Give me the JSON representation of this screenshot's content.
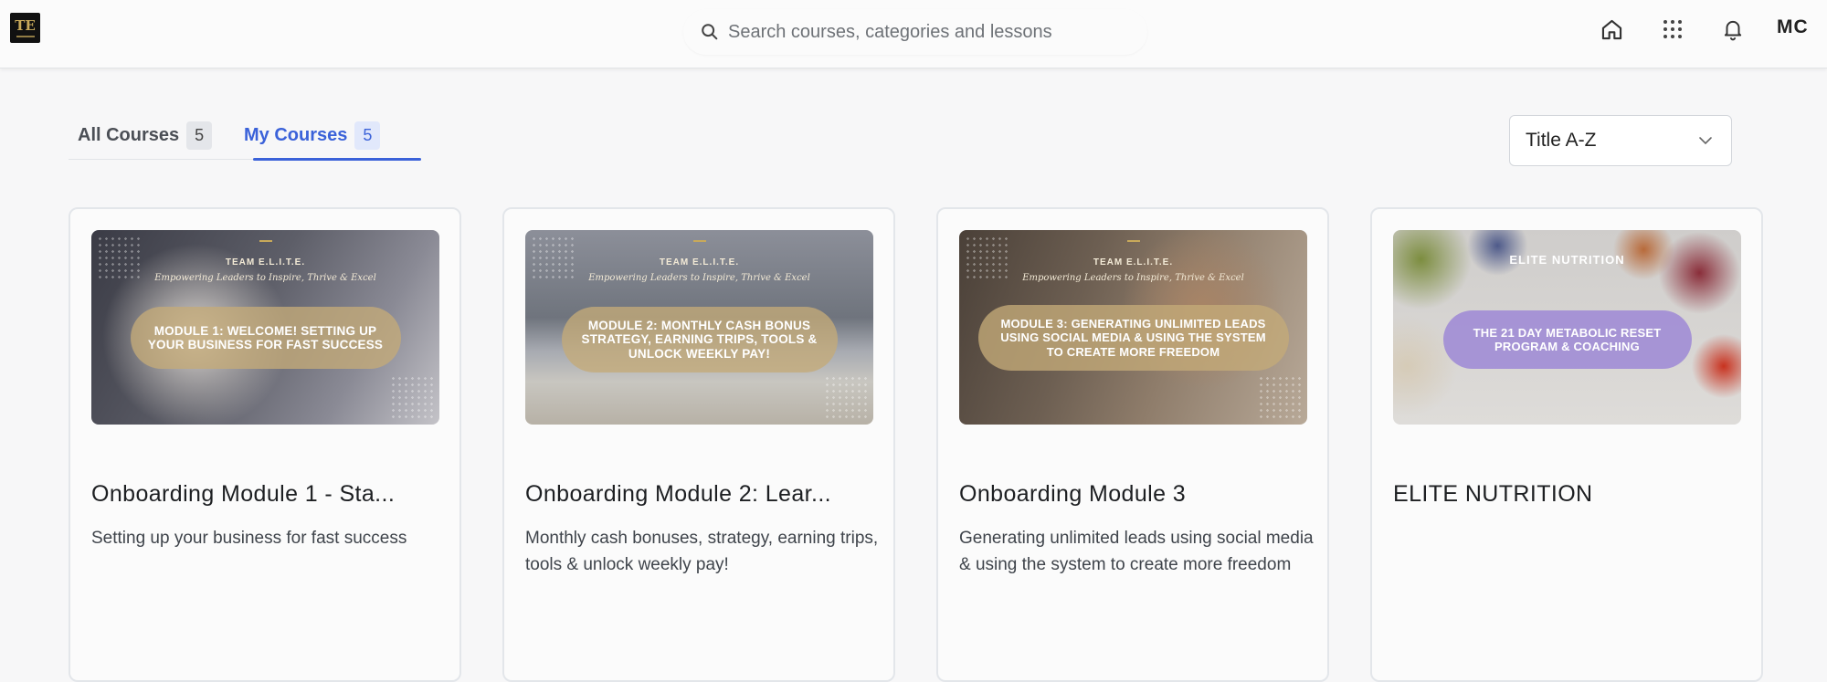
{
  "header": {
    "logo_alt": "Team E.L.I.T.E. logo",
    "search_placeholder": "Search courses, categories and lessons",
    "icons": [
      "home-icon",
      "apps-grid-icon",
      "bell-icon"
    ],
    "user_initials": "MC"
  },
  "tabs": [
    {
      "label": "All Courses",
      "count": "5",
      "active": false
    },
    {
      "label": "My Courses",
      "count": "5",
      "active": true
    }
  ],
  "sort": {
    "selected": "Title A-Z"
  },
  "courses": [
    {
      "image_brand": "TEAM E.L.I.T.E.",
      "image_tagline": "Empowering Leaders to Inspire, Thrive & Excel",
      "image_text": "MODULE 1:  WELCOME! SETTING UP YOUR BUSINESS FOR FAST SUCCESS",
      "title": "Onboarding Module 1 - Sta...",
      "description": "Setting up your business for fast success"
    },
    {
      "image_brand": "TEAM E.L.I.T.E.",
      "image_tagline": "Empowering Leaders to Inspire, Thrive & Excel",
      "image_text": "MODULE 2:  MONTHLY CASH BONUS STRATEGY, EARNING TRIPS, TOOLS & UNLOCK WEEKLY PAY!",
      "title": "Onboarding Module 2: Lear...",
      "description": "Monthly cash bonuses, strategy, earning trips, tools & unlock weekly pay!"
    },
    {
      "image_brand": "TEAM E.L.I.T.E.",
      "image_tagline": "Empowering Leaders to Inspire, Thrive & Excel",
      "image_text": "MODULE 3:  GENERATING UNLIMITED LEADS USING SOCIAL MEDIA & USING THE SYSTEM TO CREATE MORE FREEDOM",
      "title": "Onboarding Module 3",
      "description": "Generating unlimited leads using social media & using the system to create more freedom"
    },
    {
      "image_brand": "ELITE NUTRITION",
      "image_text": "THE 21 DAY METABOLIC RESET PROGRAM & COACHING",
      "title": "ELITE NUTRITION",
      "description": ""
    }
  ],
  "colors": {
    "accent": "#3b62d9",
    "pill_gold": "#c4aa78",
    "pill_purple": "#9b85d6"
  }
}
